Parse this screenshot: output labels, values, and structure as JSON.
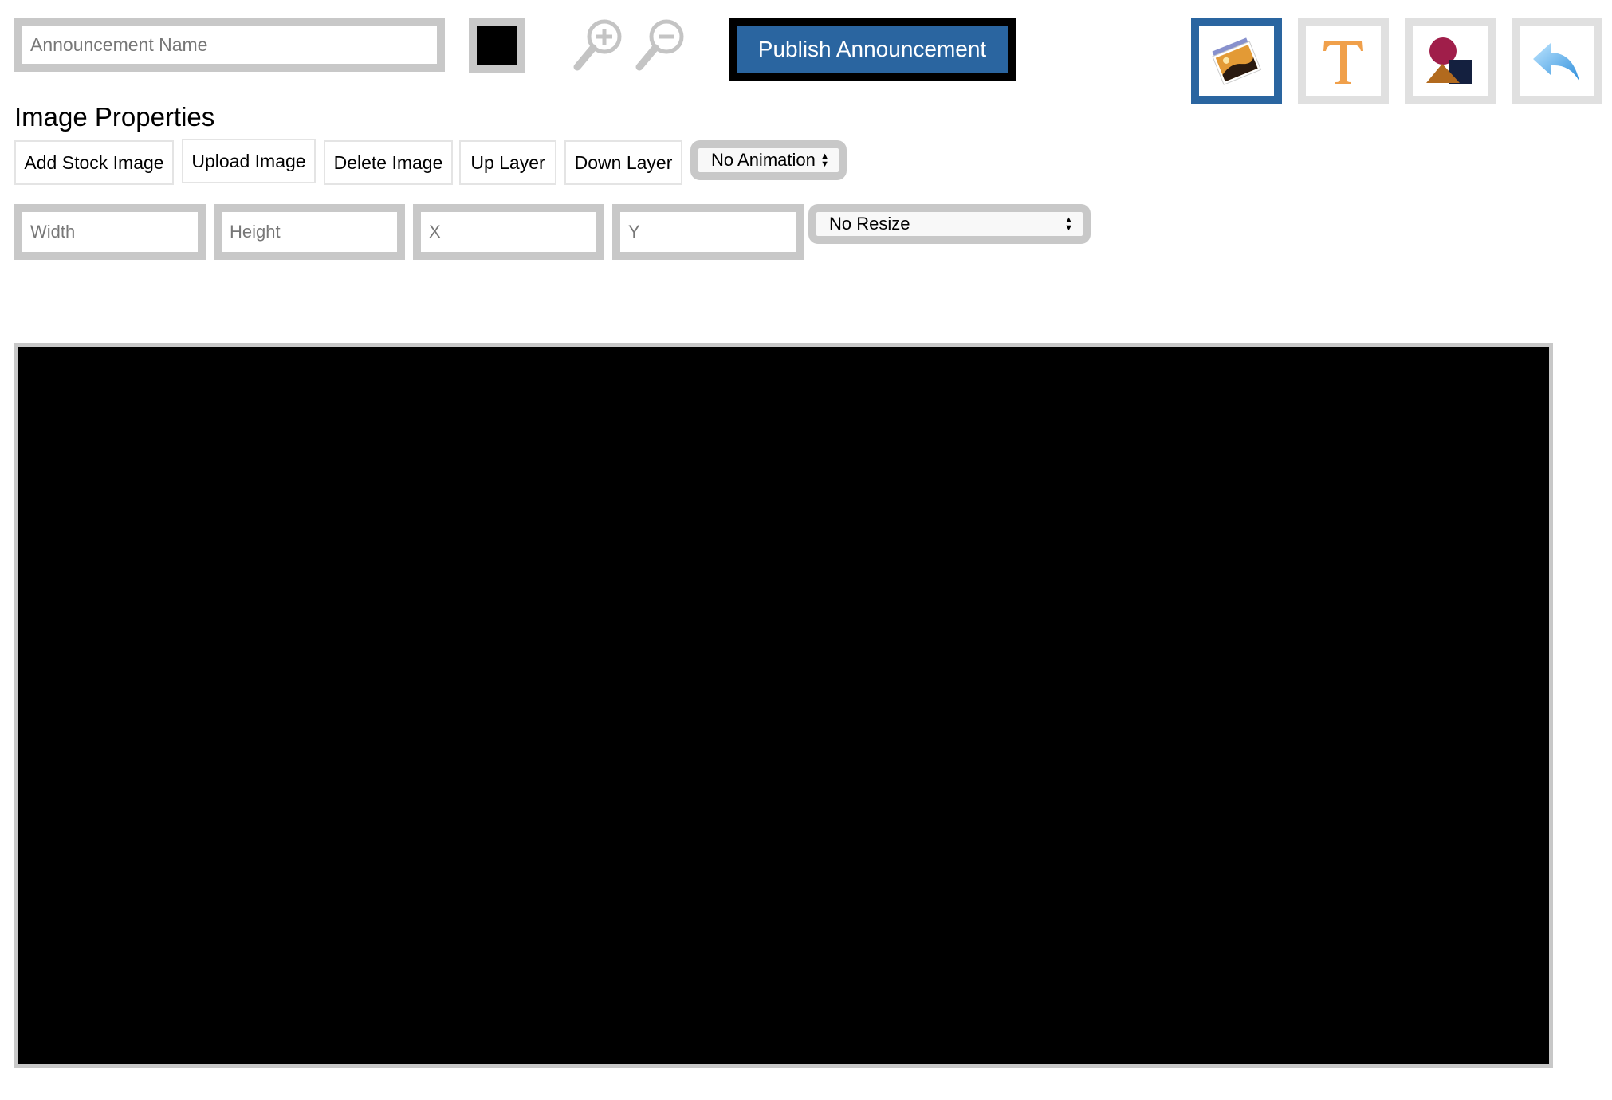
{
  "header": {
    "announcement_name": {
      "value": "",
      "placeholder": "Announcement Name"
    },
    "background_color": "#000000",
    "zoom_in_icon": "zoom-in-icon",
    "zoom_out_icon": "zoom-out-icon",
    "publish_label": "Publish Announcement",
    "accent_color": "#2a65a0"
  },
  "tools": [
    {
      "name": "image-tool",
      "icon": "image-icon",
      "active": true
    },
    {
      "name": "text-tool",
      "icon": "text-icon",
      "glyph": "T",
      "active": false
    },
    {
      "name": "shapes-tool",
      "icon": "shapes-icon",
      "active": false
    },
    {
      "name": "undo-tool",
      "icon": "undo-icon",
      "active": false
    }
  ],
  "image_properties": {
    "title": "Image Properties",
    "buttons": [
      {
        "label": "Add Stock Image"
      },
      {
        "label": "Upload Image"
      },
      {
        "label": "Delete Image"
      },
      {
        "label": "Up Layer"
      },
      {
        "label": "Down Layer"
      }
    ],
    "animation_select": {
      "selected": "No Animation"
    },
    "fields": {
      "width": {
        "value": "",
        "placeholder": "Width"
      },
      "height": {
        "value": "",
        "placeholder": "Height"
      },
      "x": {
        "value": "",
        "placeholder": "X"
      },
      "y": {
        "value": "",
        "placeholder": "Y"
      }
    },
    "resize_select": {
      "selected": "No Resize"
    }
  },
  "canvas": {
    "background_color": "#000000"
  }
}
